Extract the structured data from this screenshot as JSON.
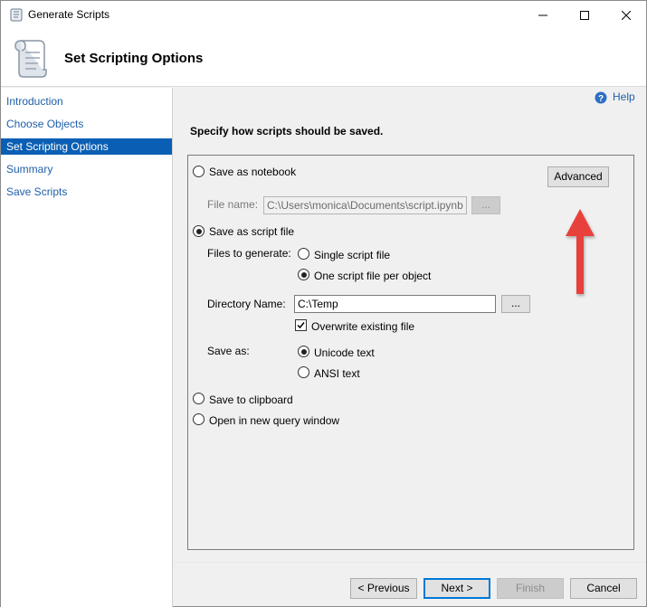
{
  "window": {
    "title": "Generate Scripts",
    "minimize_icon": "minimize-icon",
    "maximize_icon": "maximize-icon",
    "close_icon": "close-icon"
  },
  "header": {
    "title": "Set Scripting Options",
    "icon": "scroll-icon"
  },
  "sidebar": {
    "items": [
      {
        "label": "Introduction",
        "selected": false
      },
      {
        "label": "Choose Objects",
        "selected": false
      },
      {
        "label": "Set Scripting Options",
        "selected": true
      },
      {
        "label": "Summary",
        "selected": false
      },
      {
        "label": "Save Scripts",
        "selected": false
      }
    ]
  },
  "help": {
    "label": "Help",
    "icon": "help-icon"
  },
  "main": {
    "instruction": "Specify how scripts should be saved.",
    "save_notebook": {
      "label": "Save as notebook",
      "checked": false
    },
    "advanced_button": "Advanced",
    "file_name": {
      "label": "File name:",
      "value": "C:\\Users\\monica\\Documents\\script.ipynb",
      "browse": "..."
    },
    "save_script_file": {
      "label": "Save as script file",
      "checked": true
    },
    "files_to_generate": {
      "label": "Files to generate:",
      "options": [
        {
          "label": "Single script file",
          "checked": false
        },
        {
          "label": "One script file per object",
          "checked": true
        }
      ]
    },
    "directory_name": {
      "label": "Directory Name:",
      "value": "C:\\Temp",
      "browse": "..."
    },
    "overwrite": {
      "label": "Overwrite existing file",
      "checked": true
    },
    "save_as": {
      "label": "Save as:",
      "options": [
        {
          "label": "Unicode text",
          "checked": true
        },
        {
          "label": "ANSI text",
          "checked": false
        }
      ]
    },
    "save_clipboard": {
      "label": "Save to clipboard",
      "checked": false
    },
    "open_query": {
      "label": "Open in new query window",
      "checked": false
    }
  },
  "footer": {
    "previous": "< Previous",
    "next": "Next >",
    "finish": "Finish",
    "cancel": "Cancel"
  },
  "colors": {
    "accent": "#0a5fb4",
    "link": "#1f5fa8",
    "annotation_arrow": "#e8403a"
  }
}
